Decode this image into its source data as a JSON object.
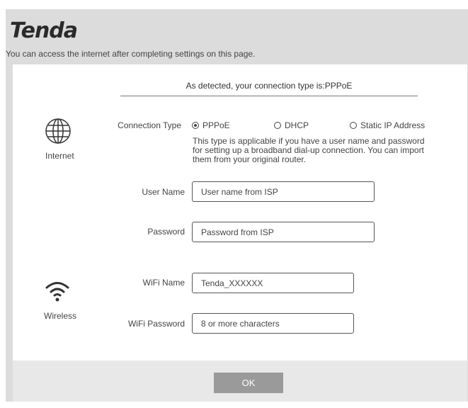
{
  "brand": {
    "logo": "Tenda"
  },
  "header": {
    "subtitle": "You can access the internet after completing settings on this page."
  },
  "detected": {
    "text": "As detected, your connection type is:PPPoE"
  },
  "sections": {
    "internet": {
      "label": "Internet",
      "icon": "globe-icon"
    },
    "wireless": {
      "label": "Wireless",
      "icon": "wifi-icon"
    }
  },
  "connection": {
    "label": "Connection Type",
    "options": [
      {
        "label": "PPPoE",
        "selected": true
      },
      {
        "label": "DHCP",
        "selected": false
      },
      {
        "label": "Static IP Address",
        "selected": false
      }
    ],
    "description": "This type is applicable if you have a user name and password for setting up a broadband dial-up connection. You can import them from your original router."
  },
  "pppoe": {
    "username_label": "User Name",
    "username_placeholder": "User name from ISP",
    "password_label": "Password",
    "password_placeholder": "Password from ISP"
  },
  "wifi": {
    "name_label": "WiFi Name",
    "name_value": "Tenda_XXXXXX",
    "password_label": "WiFi Password",
    "password_placeholder": "8 or more characters"
  },
  "footer": {
    "ok_label": "OK"
  },
  "colors": {
    "ok_button": "#9a9a9a",
    "frame": "#dcdcdc",
    "footer": "#e8e8e8"
  }
}
